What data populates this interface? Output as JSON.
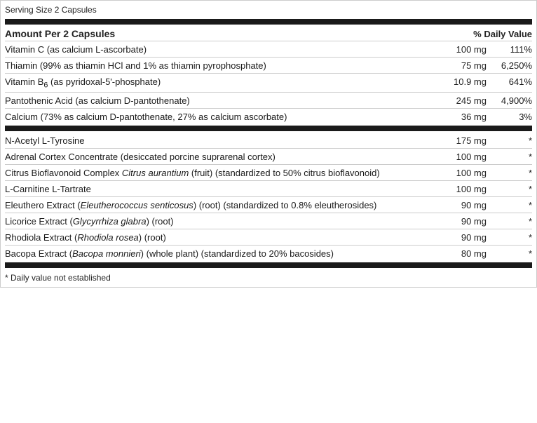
{
  "label": {
    "serving_size": "Serving Size 2 Capsules",
    "amount_per": "Amount Per 2 Capsules",
    "daily_value_header": "% Daily Value",
    "nutrients_top": [
      {
        "name": "Vitamin C (as calcium L-ascorbate)",
        "amount": "100 mg",
        "dv": "111%",
        "italic_part": null
      },
      {
        "name": "Thiamin (99% as thiamin HCl and 1% as thiamin pyrophosphate)",
        "amount": "75 mg",
        "dv": "6,250%",
        "italic_part": null
      },
      {
        "name_prefix": "Vitamin B",
        "name_sub": "6",
        "name_suffix": " (as pyridoxal-5'-phosphate)",
        "amount": "10.9 mg",
        "dv": "641%",
        "italic_part": null,
        "special": "b6"
      },
      {
        "name": "Pantothenic Acid (as calcium D-pantothenate)",
        "amount": "245 mg",
        "dv": "4,900%",
        "italic_part": null
      },
      {
        "name": "Calcium (73% as calcium D-pantothenate, 27% as calcium ascorbate)",
        "amount": "36 mg",
        "dv": "3%",
        "italic_part": null
      }
    ],
    "nutrients_bottom": [
      {
        "name": "N-Acetyl L-Tyrosine",
        "amount": "175 mg",
        "dv": "*"
      },
      {
        "name": "Adrenal Cortex Concentrate (desiccated porcine suprarenal cortex)",
        "amount": "100 mg",
        "dv": "*"
      },
      {
        "name_plain": "Citrus Bioflavonoid Complex ",
        "name_italic": "Citrus aurantium",
        "name_after": " (fruit) (standardized to 50% citrus bioflavonoid)",
        "amount": "100 mg",
        "dv": "*",
        "special": "italic"
      },
      {
        "name": "L-Carnitine L-Tartrate",
        "amount": "100 mg",
        "dv": "*"
      },
      {
        "name_plain": "Eleuthero Extract ",
        "name_italic": "Eleutherococcus senticosus",
        "name_after": " (root) (standardized to 0.8% eleutherosides)",
        "amount": "90 mg",
        "dv": "*",
        "special": "italic"
      },
      {
        "name_plain": "Licorice Extract ",
        "name_italic": "Glycyrrhiza glabra",
        "name_after": " (root)",
        "amount": "90 mg",
        "dv": "*",
        "special": "italic"
      },
      {
        "name_plain": "Rhodiola Extract ",
        "name_italic": "Rhodiola rosea",
        "name_after": " (root)",
        "amount": "90 mg",
        "dv": "*",
        "special": "italic"
      },
      {
        "name_plain": "Bacopa Extract ",
        "name_italic": "Bacopa monnieri",
        "name_after": " (whole plant) (standardized to 20% bacosides)",
        "amount": "80 mg",
        "dv": "*",
        "special": "italic"
      }
    ],
    "footnote": "* Daily value not established"
  }
}
